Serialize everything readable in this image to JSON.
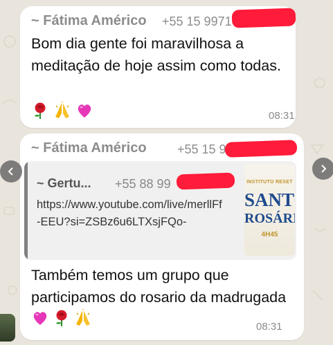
{
  "messages": [
    {
      "sender": "~ Fátima Américo",
      "phone": "+55 15 9971",
      "text": "Bom dia gente foi maravilhosa a meditação  de hoje assim como todas.",
      "emojis": [
        "rose",
        "praying-hands",
        "heart"
      ],
      "time": "08:31"
    },
    {
      "sender": "~ Fátima Américo",
      "phone": "+55 15 9",
      "quoted": {
        "sender": "~ Gertu...",
        "phone": "+55 88 99",
        "url": "https://www.youtube.com/live/merllFf-EEU?si=ZSBz6u6LTXsjFQo-",
        "thumbnail": {
          "institute": "INSTITUTO RESET",
          "title_line1": "SANTO",
          "title_line2": "ROSÁRIO",
          "time": "4H45"
        }
      },
      "text": "Também  temos um grupo que participamos do rosario da madrugada",
      "emojis": [
        "heart",
        "rose",
        "praying-hands"
      ],
      "time": "08:31"
    }
  ],
  "colors": {
    "redaction": "#ff1b3a",
    "background": "#e9e4dc",
    "bubble": "#ffffff"
  }
}
